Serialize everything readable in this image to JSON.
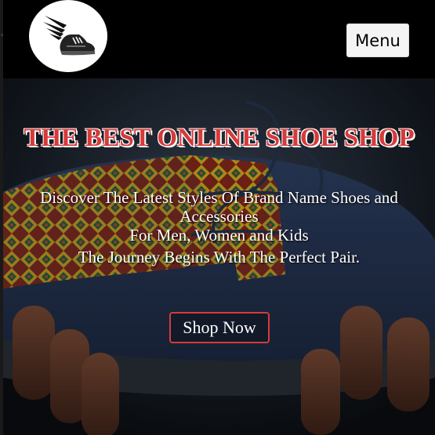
{
  "header": {
    "logo_icon": "winged-shoe-icon",
    "menu_label": "Menu"
  },
  "hero": {
    "title": "THE BEST ONLINE SHOE SHOP",
    "subtitle_line1": "Discover The Latest Styles Of Brand Name Shoes and Accessories",
    "subtitle_line2": "For Men, Women and Kids",
    "subtitle_line3": "The Journey Begins With The Perfect Pair.",
    "cta_label": "Shop Now"
  },
  "colors": {
    "header_bg": "#000000",
    "accent_red": "#d63a3a",
    "menu_button_bg": "#f4f4f4",
    "hero_text": "#ffffff",
    "denim": "#2b3a55"
  }
}
